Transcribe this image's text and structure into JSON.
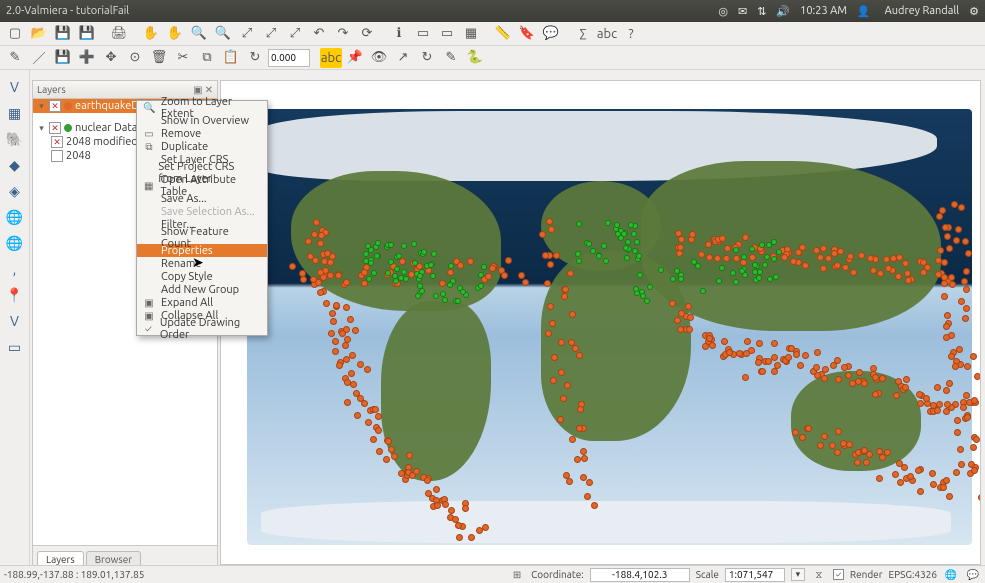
{
  "sysbar": {
    "title": "2.0-Valmiera - tutorialFail",
    "time": "10:23 AM",
    "user": "Audrey Randall"
  },
  "toolbar1": {
    "numbox_value": "0.000"
  },
  "layers": {
    "title": "Layers",
    "items": [
      {
        "name": "earthquakeData",
        "selected": true,
        "checked": true
      },
      {
        "name": "nuclear Data",
        "checked": true
      },
      {
        "name": "2048 modified",
        "checked": true
      },
      {
        "name": "2048",
        "checked": false
      }
    ],
    "tabs": {
      "a": "Layers",
      "b": "Browser"
    }
  },
  "context_menu": {
    "items": [
      {
        "label": "Zoom to Layer Extent",
        "icon": "🔍"
      },
      {
        "label": "Show in Overview"
      },
      {
        "label": "Remove",
        "icon": "✖"
      },
      {
        "label": "Duplicate",
        "icon": "⧉"
      },
      {
        "label": "Set Layer CRS"
      },
      {
        "label": "Set Project CRS from Layer"
      },
      {
        "label": "Open Attribute Table",
        "icon": "▦"
      },
      {
        "label": "Save As..."
      },
      {
        "label": "Save Selection As...",
        "disabled": true
      },
      {
        "label": "Filter..."
      },
      {
        "label": "Show Feature Count"
      },
      {
        "label": "Properties",
        "hover": true
      },
      {
        "label": "Rename"
      },
      {
        "label": "Copy Style"
      },
      {
        "label": "Add New Group"
      },
      {
        "label": "Expand All",
        "icon": "▣"
      },
      {
        "label": "Collapse All",
        "icon": "▣"
      },
      {
        "label": "Update Drawing Order",
        "icon": "✓"
      }
    ]
  },
  "status": {
    "extents": "-188.99,-137.88 : 189.01,137.85",
    "coord_label": "Coordinate:",
    "coord_value": "-188.4,102.3",
    "scale_label": "Scale",
    "scale_value": "1:071,547",
    "render_label": "Render",
    "crs": "EPSG:4326"
  }
}
